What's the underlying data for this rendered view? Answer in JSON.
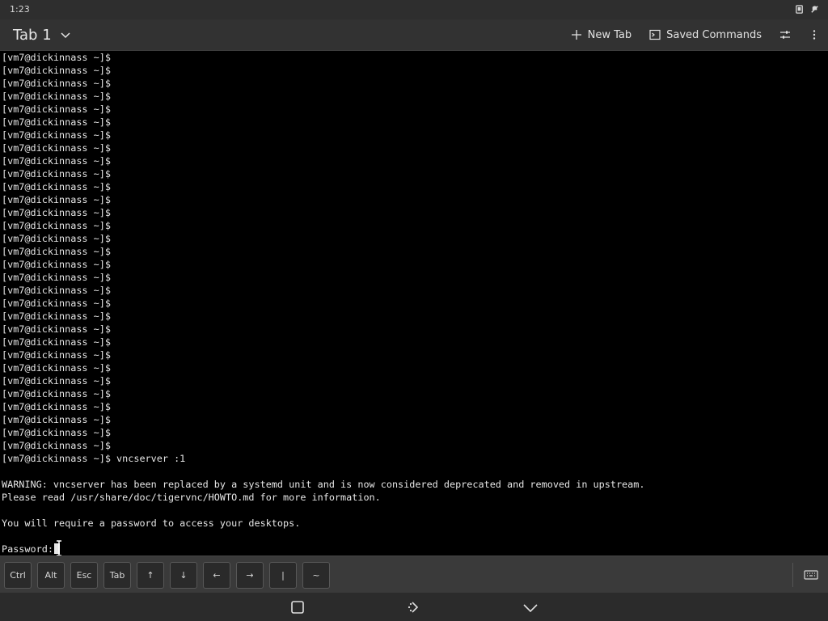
{
  "status": {
    "time": "1:23"
  },
  "tabbar": {
    "title": "Tab 1",
    "new_tab": "New Tab",
    "saved_commands": "Saved Commands"
  },
  "terminal": {
    "lines": [
      "[vm7@dickinnass ~]$",
      "[vm7@dickinnass ~]$",
      "[vm7@dickinnass ~]$",
      "[vm7@dickinnass ~]$",
      "[vm7@dickinnass ~]$",
      "[vm7@dickinnass ~]$",
      "[vm7@dickinnass ~]$",
      "[vm7@dickinnass ~]$",
      "[vm7@dickinnass ~]$",
      "[vm7@dickinnass ~]$",
      "[vm7@dickinnass ~]$",
      "[vm7@dickinnass ~]$",
      "[vm7@dickinnass ~]$",
      "[vm7@dickinnass ~]$",
      "[vm7@dickinnass ~]$",
      "[vm7@dickinnass ~]$",
      "[vm7@dickinnass ~]$",
      "[vm7@dickinnass ~]$",
      "[vm7@dickinnass ~]$",
      "[vm7@dickinnass ~]$",
      "[vm7@dickinnass ~]$",
      "[vm7@dickinnass ~]$",
      "[vm7@dickinnass ~]$",
      "[vm7@dickinnass ~]$",
      "[vm7@dickinnass ~]$",
      "[vm7@dickinnass ~]$",
      "[vm7@dickinnass ~]$",
      "[vm7@dickinnass ~]$",
      "[vm7@dickinnass ~]$",
      "[vm7@dickinnass ~]$",
      "[vm7@dickinnass ~]$",
      "[vm7@dickinnass ~]$ vncserver :1",
      "",
      "WARNING: vncserver has been replaced by a systemd unit and is now considered deprecated and removed in upstream.",
      "Please read /usr/share/doc/tigervnc/HOWTO.md for more information.",
      "",
      "You will require a password to access your desktops.",
      ""
    ],
    "prompt": "Password:"
  },
  "extra_keys": [
    "Ctrl",
    "Alt",
    "Esc",
    "Tab",
    "↑",
    "↓",
    "←",
    "→",
    "|",
    "~"
  ],
  "colors": {
    "terminal_bg": "#000000",
    "terminal_fg": "#e6e6e6",
    "chrome_bg": "#323232"
  }
}
